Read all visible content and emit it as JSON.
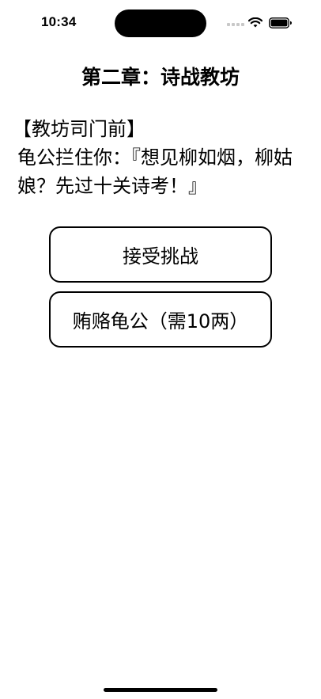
{
  "status_bar": {
    "time": "10:34",
    "icons": [
      "signal-icon",
      "wifi-icon",
      "battery-icon"
    ]
  },
  "game": {
    "chapter_title": "第二章：诗战教坊",
    "scene": {
      "location": "【教坊司门前】",
      "dialogue": "龟公拦住你：『想见柳如烟，柳姑娘？先过十关诗考！』"
    },
    "choices": [
      {
        "label": "接受挑战"
      },
      {
        "label": "贿赂龟公（需10两）"
      }
    ]
  },
  "colors": {
    "background": "#ffffff",
    "text": "#000000",
    "button_border": "#000000"
  }
}
